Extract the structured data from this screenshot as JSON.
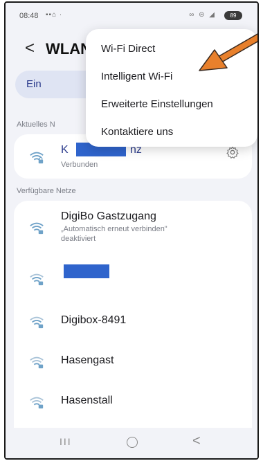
{
  "status_bar": {
    "time": "08:48",
    "left_icons": "▪▪⌂ ·",
    "right_icons": "∞ ⊜ ◢",
    "battery": "89"
  },
  "app_bar": {
    "back_glyph": "<",
    "title": "WLAN"
  },
  "master_switch": {
    "label": "Ein"
  },
  "current_network": {
    "section_label": "Aktuelles N",
    "name": "K",
    "name_suffix": "nz",
    "status": "Verbunden"
  },
  "available": {
    "section_label": "Verfügbare Netze",
    "networks": [
      {
        "name": "DigiBo Gastzugang",
        "sub1": "„Automatisch erneut verbinden\"",
        "sub2": "deaktiviert"
      },
      {
        "name": "",
        "redacted": true
      },
      {
        "name": "Digibox-8491"
      },
      {
        "name": "Hasengast"
      },
      {
        "name": "Hasenstall"
      }
    ]
  },
  "menu": {
    "items": [
      "Wi-Fi Direct",
      "Intelligent Wi-Fi",
      "Erweiterte Einstellungen",
      "Kontaktiere uns"
    ]
  },
  "nav_bar": {
    "recents": "III",
    "back": "<"
  },
  "colors": {
    "redaction": "#2f64cc",
    "arrow": "#e8802c",
    "wifi_icon": "#6fa2c8",
    "master_bg": "#dfe4f3"
  }
}
